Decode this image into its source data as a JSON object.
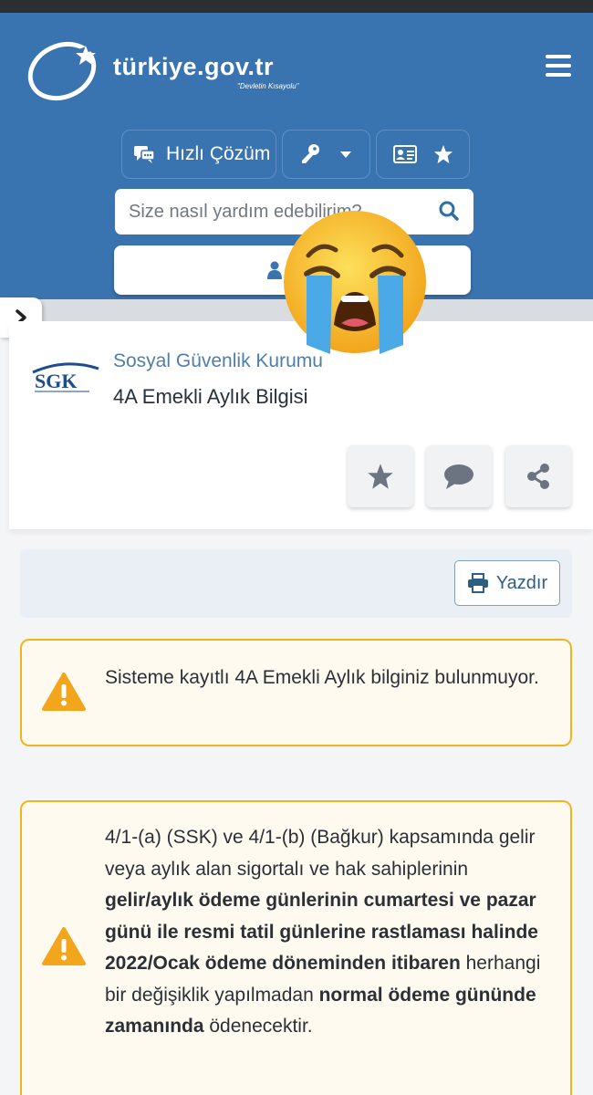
{
  "header": {
    "brand": "türkiye.gov.tr",
    "slogan": "\"Devletin Kısayolu\"",
    "quick_solution_label": "Hızlı Çözüm",
    "search_placeholder": "Size nasıl yardım edebilirim?",
    "menu_label": "ME"
  },
  "service": {
    "institution": "Sosyal Güvenlik Kurumu",
    "title": "4A Emekli Aylık Bilgisi",
    "logo_text": "SGK"
  },
  "toolbar": {
    "print_label": "Yazdır"
  },
  "alerts": [
    {
      "text": "Sisteme kayıtlı 4A Emekli Aylık bilginiz bulunmuyor."
    },
    {
      "part1": "4/1-(a) (SSK) ve 4/1-(b) (Bağkur) kapsamında gelir veya aylık alan sigortalı ve hak sahiplerinin ",
      "bold1": "gelir/aylık ödeme günlerinin cumartesi ve pazar günü ile resmi tatil günlerine rastlaması halinde 2022/Ocak ödeme döneminden itibaren",
      "part2": " herhangi bir değişiklik yapılmadan ",
      "bold2": "normal ödeme gününde zamanında",
      "part3": " ödenecektir."
    }
  ],
  "colors": {
    "header_blue": "#3a74b0",
    "warning_orange": "#f1b51c",
    "link_blue": "#4e7fa8"
  },
  "icons": [
    "logo-icon",
    "hamburger-icon",
    "chat-icon",
    "key-icon",
    "caret-down-icon",
    "id-card-icon",
    "star-icon",
    "search-icon",
    "user-icon",
    "chevron-right-icon",
    "crying-face-emoji",
    "comment-icon",
    "share-icon",
    "print-icon",
    "warning-icon"
  ]
}
